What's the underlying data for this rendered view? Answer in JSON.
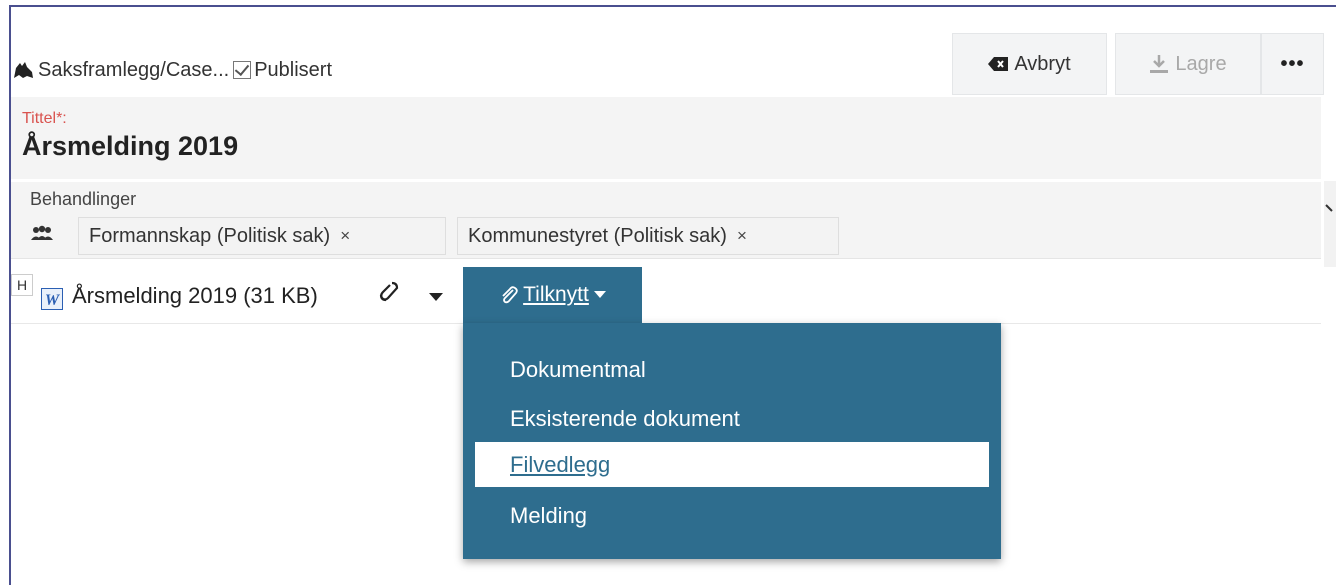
{
  "header": {
    "case_type": "Saksframlegg/Case...",
    "published_label": "Publisert",
    "cancel_label": "Avbryt",
    "save_label": "Lagre",
    "more_label": "•••"
  },
  "title_field": {
    "label": "Tittel*:",
    "value": "Årsmelding 2019"
  },
  "behandlinger": {
    "label": "Behandlinger",
    "tags": [
      "Formannskap (Politisk sak)",
      "Kommunestyret (Politisk sak)"
    ],
    "remove_symbol": "×"
  },
  "document": {
    "badge": "H",
    "name": "Årsmelding 2019 (31 KB)",
    "attach_label": "Tilknytt"
  },
  "attach_menu": {
    "items": [
      "Dokumentmal",
      "Eksisterende dokument",
      "Filvedlegg",
      "Melding"
    ],
    "active_index": 2
  },
  "colors": {
    "primary": "#2e6d8e",
    "required": "#d9534f",
    "panel_bg": "#f4f4f4"
  }
}
